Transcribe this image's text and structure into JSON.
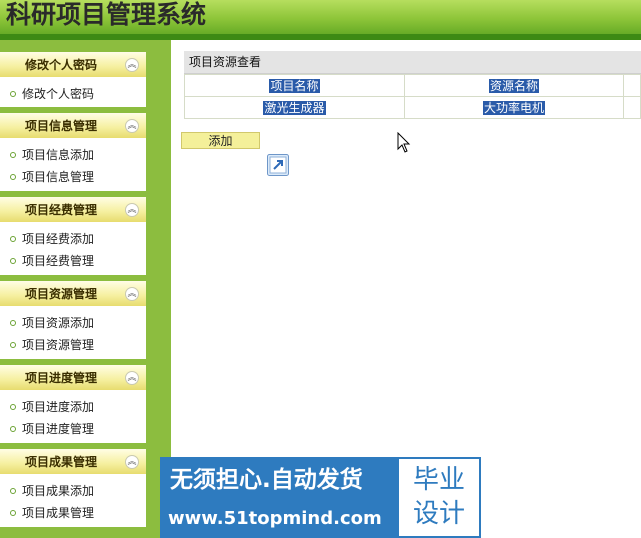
{
  "header": {
    "title": "科研项目管理系统"
  },
  "sidebar": {
    "groups": [
      {
        "title": "修改个人密码",
        "toggle": "︽",
        "items": [
          "修改个人密码"
        ]
      },
      {
        "title": "项目信息管理",
        "toggle": "︽",
        "items": [
          "项目信息添加",
          "项目信息管理"
        ]
      },
      {
        "title": "项目经费管理",
        "toggle": "︽",
        "items": [
          "项目经费添加",
          "项目经费管理"
        ]
      },
      {
        "title": "项目资源管理",
        "toggle": "︽",
        "items": [
          "项目资源添加",
          "项目资源管理"
        ]
      },
      {
        "title": "项目进度管理",
        "toggle": "︽",
        "items": [
          "项目进度添加",
          "项目进度管理"
        ]
      },
      {
        "title": "项目成果管理",
        "toggle": "︽",
        "items": [
          "项目成果添加",
          "项目成果管理"
        ]
      }
    ]
  },
  "main": {
    "panel_title": "项目资源查看",
    "table": {
      "headers": [
        "项目名称",
        "资源名称"
      ],
      "rows": [
        [
          "激光生成器",
          "大功率电机"
        ]
      ]
    },
    "add_label": "添加"
  },
  "watermark": {
    "line1": "无须担心.自动发货",
    "line2": "www.51topmind.com",
    "right1": "毕业",
    "right2": "设计",
    "color": "#2e7bbf"
  },
  "colors": {
    "header": "#8fc63a",
    "sidebar": "#8cbd3f",
    "group_head": "#f6f0a2",
    "selection": "#2a5ba9",
    "add_button": "#f4f09a"
  }
}
